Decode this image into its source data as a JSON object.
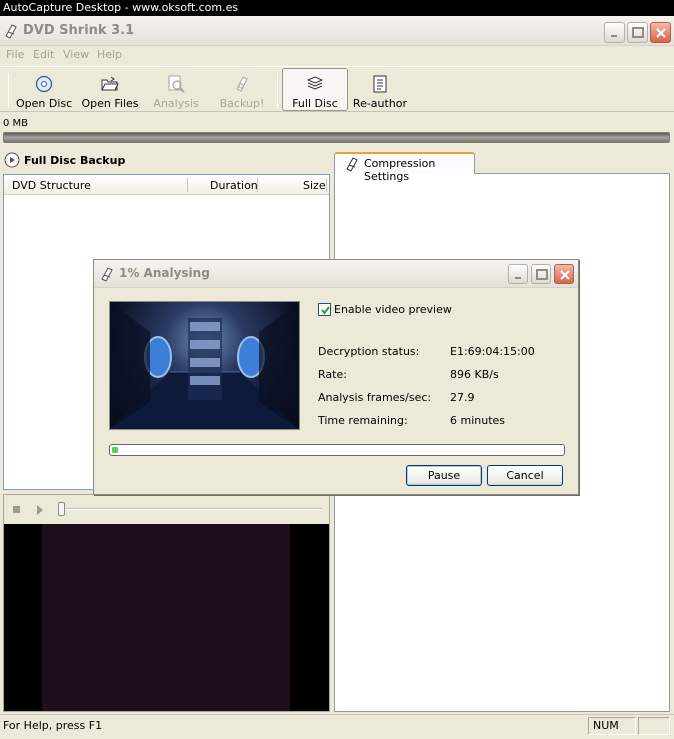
{
  "capture_bar": {
    "text": "AutoCapture Desktop - www.oksoft.com.es"
  },
  "window": {
    "title": "DVD Shrink 3.1"
  },
  "menu": [
    "File",
    "Edit",
    "View",
    "Help"
  ],
  "toolbar": {
    "open_disc": "Open Disc",
    "open_files": "Open Files",
    "analysis": "Analysis",
    "backup": "Backup!",
    "full_disc": "Full Disc",
    "re_author": "Re-author"
  },
  "size_indicator": "0 MB",
  "left_pane": {
    "title": "Full Disc Backup",
    "columns": [
      "DVD Structure",
      "Duration",
      "Size"
    ]
  },
  "right_pane": {
    "tab_label": "Compression Settings"
  },
  "dialog": {
    "title": "1% Analysing",
    "enable_preview_label": "Enable video preview",
    "enable_preview_checked": true,
    "rows": [
      {
        "label": "Decryption status:",
        "value": "E1:69:04:15:00"
      },
      {
        "label": "Rate:",
        "value": "896 KB/s"
      },
      {
        "label": "Analysis frames/sec:",
        "value": "27.9"
      },
      {
        "label": "Time remaining:",
        "value": "6 minutes"
      }
    ],
    "progress_fraction": 0.01,
    "pause_label": "Pause",
    "cancel_label": "Cancel"
  },
  "statusbar": {
    "help_text": "For Help, press F1",
    "num_indicator": "NUM"
  }
}
